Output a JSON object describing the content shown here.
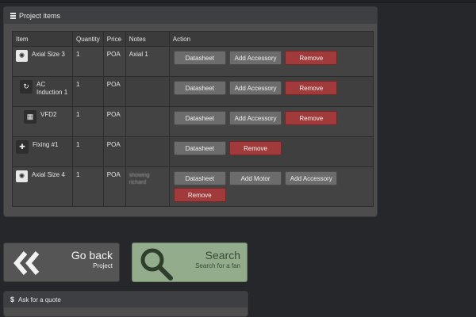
{
  "panel": {
    "title": "Project items",
    "columns": [
      "Item",
      "Quantity",
      "Price",
      "Notes",
      "Action"
    ]
  },
  "rows": [
    {
      "item": "Axial Size 3",
      "icon": "fan-icon",
      "quantity": "1",
      "price": "POA",
      "notes": "Axial 1",
      "actions": [
        {
          "label": "Datasheet",
          "kind": "grey"
        },
        {
          "label": "Add Accessory",
          "kind": "grey"
        },
        {
          "label": "Remove",
          "kind": "red"
        }
      ]
    },
    {
      "item": "AC Induction 1",
      "icon": "motor-icon",
      "quantity": "1",
      "price": "POA",
      "notes": "",
      "actions": [
        {
          "label": "Datasheet",
          "kind": "grey"
        },
        {
          "label": "Add Accessory",
          "kind": "grey"
        },
        {
          "label": "Remove",
          "kind": "red"
        }
      ]
    },
    {
      "item": "VFD2",
      "icon": "drive-icon",
      "quantity": "1",
      "price": "POA",
      "notes": "",
      "actions": [
        {
          "label": "Datasheet",
          "kind": "grey"
        },
        {
          "label": "Add Accessory",
          "kind": "grey"
        },
        {
          "label": "Remove",
          "kind": "red"
        }
      ]
    },
    {
      "item": "Fixing #1",
      "icon": "fixing-icon",
      "quantity": "1",
      "price": "POA",
      "notes": "",
      "actions": [
        {
          "label": "Datasheet",
          "kind": "grey"
        },
        {
          "label": "Remove",
          "kind": "red"
        }
      ]
    },
    {
      "item": "Axial Size 4",
      "icon": "fan-icon",
      "quantity": "1",
      "price": "POA",
      "notes": "showing richard",
      "actions": [
        {
          "label": "Datasheet",
          "kind": "grey"
        },
        {
          "label": "Add Motor",
          "kind": "grey"
        },
        {
          "label": "Add Accessory",
          "kind": "grey"
        },
        {
          "label": "Remove",
          "kind": "red"
        }
      ]
    }
  ],
  "tiles": {
    "back": {
      "title": "Go back",
      "subtitle": "Project"
    },
    "search": {
      "title": "Search",
      "subtitle": "Search for a fan"
    }
  },
  "quote": {
    "title": "Ask for a quote"
  },
  "colors": {
    "remove": "#a13b3b",
    "search_tile": "#93ac8c",
    "panel": "#4d4d4d"
  }
}
